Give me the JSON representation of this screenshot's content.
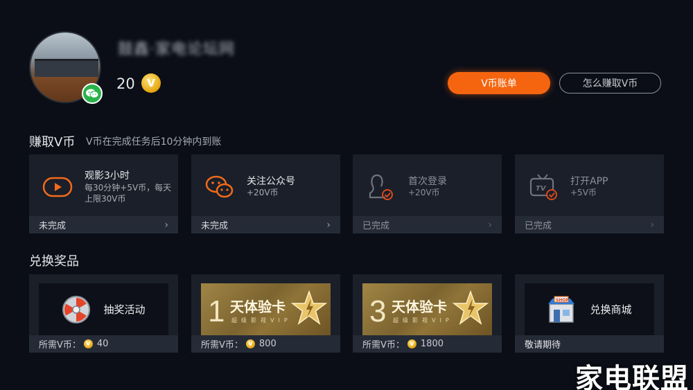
{
  "profile": {
    "username": "鼓鑫·家电论坛网",
    "coin_count": "20",
    "coin_symbol": "V",
    "login_badge_icon": "wechat-icon"
  },
  "header_buttons": {
    "bill": "V币账单",
    "earn": "怎么赚取V币"
  },
  "earn_section": {
    "title": "赚取V币",
    "subtitle": "V币在完成任务后10分钟内到账",
    "tasks": [
      {
        "title": "观影3小时",
        "desc": "每30分钟+5V币，每天上限30V币",
        "status": "未完成",
        "icon": "play-icon",
        "accent": "#f26a1b"
      },
      {
        "title": "关注公众号",
        "desc": "+20V币",
        "status": "未完成",
        "icon": "wechat-icon",
        "accent": "#f26a1b"
      },
      {
        "title": "首次登录",
        "desc": "+20V币",
        "status": "已完成",
        "icon": "user-check-icon",
        "accent": "#d9491c"
      },
      {
        "title": "打开APP",
        "desc": "+5V币",
        "status": "已完成",
        "icon": "tv-check-icon",
        "accent": "#d9491c"
      }
    ]
  },
  "prize_section": {
    "title": "兑换奖品",
    "cost_label": "所需V币：",
    "prizes": [
      {
        "name": "抽奖活动",
        "cost": "40",
        "icon": "lottery-wheel-icon"
      },
      {
        "card_number": "1",
        "card_name": "天体验卡",
        "card_sub": "超级影视VIP",
        "cost": "800",
        "icon": "star-icon"
      },
      {
        "card_number": "3",
        "card_name": "天体验卡",
        "card_sub": "超级影视VIP",
        "cost": "1800",
        "icon": "star-icon"
      },
      {
        "name": "兑换商城",
        "shop_sign": "SHOP",
        "status": "敬请期待",
        "icon": "shop-icon"
      }
    ]
  },
  "watermark": "家电联盟",
  "colors": {
    "accent": "#f5650f",
    "background": "#0b0e17",
    "card": "#1a1f29"
  }
}
